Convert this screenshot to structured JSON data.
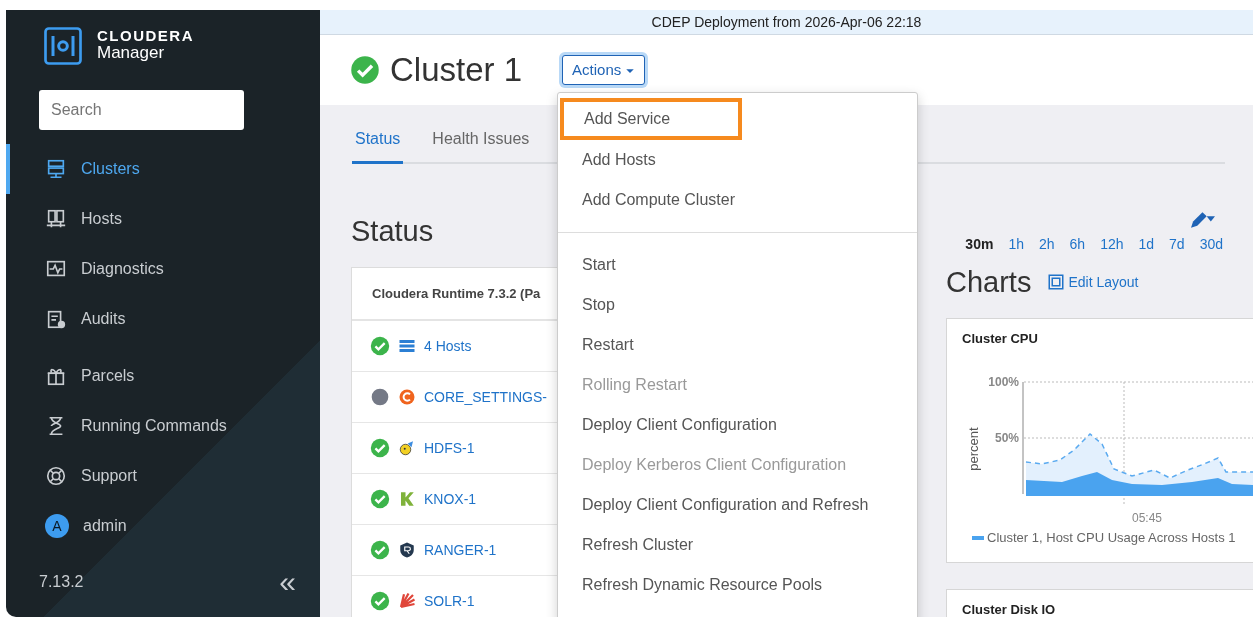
{
  "sidebar": {
    "brand": {
      "name": "CLOUDERA",
      "product": "Manager"
    },
    "search": {
      "placeholder": "Search"
    },
    "items": [
      {
        "label": "Clusters",
        "kind": "clusters",
        "selected": true
      },
      {
        "label": "Hosts",
        "kind": "hosts",
        "selected": false
      },
      {
        "label": "Diagnostics",
        "kind": "diagnostics",
        "selected": false
      },
      {
        "label": "Audits",
        "kind": "audits",
        "selected": false
      },
      {
        "label": "Parcels",
        "kind": "parcels",
        "selected": false
      },
      {
        "label": "Running Commands",
        "kind": "commands",
        "selected": false
      },
      {
        "label": "Support",
        "kind": "support",
        "selected": false
      },
      {
        "label": "admin",
        "kind": "user",
        "avatar_letter": "A",
        "selected": false
      }
    ],
    "version": "7.13.2",
    "collapse": "«"
  },
  "banner": "CDEP Deployment from 2026-Apr-06 22:18",
  "header": {
    "title": "Cluster 1",
    "healthy": true,
    "actions_button": "Actions"
  },
  "tabs": [
    {
      "label": "Status",
      "selected": true
    },
    {
      "label": "Health Issues",
      "selected": false
    }
  ],
  "status_section": {
    "heading": "Status",
    "card_header": "Cloudera Runtime 7.3.2 (Pa",
    "services": [
      {
        "name": "4 Hosts",
        "healthy": true,
        "kind": "hosts"
      },
      {
        "name": "CORE_SETTINGS-",
        "healthy": false,
        "kind": "core"
      },
      {
        "name": "HDFS-1",
        "healthy": true,
        "kind": "hdfs"
      },
      {
        "name": "KNOX-1",
        "healthy": true,
        "kind": "knox"
      },
      {
        "name": "RANGER-1",
        "healthy": true,
        "kind": "ranger"
      },
      {
        "name": "SOLR-1",
        "healthy": true,
        "kind": "solr"
      }
    ]
  },
  "actions_menu": {
    "groups": [
      [
        {
          "label": "Add Service",
          "disabled": false,
          "highlighted": true
        },
        {
          "label": "Add Hosts",
          "disabled": false,
          "highlighted": false
        },
        {
          "label": "Add Compute Cluster",
          "disabled": false,
          "highlighted": false
        }
      ],
      [
        {
          "label": "Start",
          "disabled": false,
          "highlighted": false
        },
        {
          "label": "Stop",
          "disabled": false,
          "highlighted": false
        },
        {
          "label": "Restart",
          "disabled": false,
          "highlighted": false
        },
        {
          "label": "Rolling Restart",
          "disabled": true,
          "highlighted": false
        },
        {
          "label": "Deploy Client Configuration",
          "disabled": false,
          "highlighted": false
        },
        {
          "label": "Deploy Kerberos Client Configuration",
          "disabled": true,
          "highlighted": false
        },
        {
          "label": "Deploy Client Configuration and Refresh",
          "disabled": false,
          "highlighted": false
        },
        {
          "label": "Refresh Cluster",
          "disabled": false,
          "highlighted": false
        },
        {
          "label": "Refresh Dynamic Resource Pools",
          "disabled": false,
          "highlighted": false
        }
      ]
    ]
  },
  "charts_section": {
    "time_ranges": [
      {
        "label": "30m",
        "selected": true
      },
      {
        "label": "1h",
        "selected": false
      },
      {
        "label": "2h",
        "selected": false
      },
      {
        "label": "6h",
        "selected": false
      },
      {
        "label": "12h",
        "selected": false
      },
      {
        "label": "1d",
        "selected": false
      },
      {
        "label": "7d",
        "selected": false
      },
      {
        "label": "30d",
        "selected": false
      }
    ],
    "heading": "Charts",
    "edit_layout": "Edit Layout",
    "charts": [
      {
        "title": "Cluster CPU",
        "ylabel": "percent",
        "y_ticks": [
          "100%",
          "50%"
        ],
        "x_tick": "05:45",
        "legend": "Cluster 1, Host CPU Usage Across Hosts 1"
      },
      {
        "title": "Cluster Disk IO"
      }
    ]
  }
}
